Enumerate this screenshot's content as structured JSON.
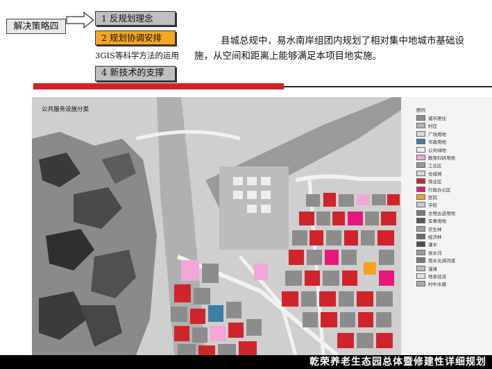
{
  "header": {
    "strategy_label": "解决策略四",
    "steps": [
      {
        "label": "1  反规划理念"
      },
      {
        "label": "2  规划协调安排"
      },
      {
        "label": "3GIS等科学方法的运用"
      },
      {
        "label": "4  新技术的支撑"
      }
    ],
    "description": "县城总规中，易水南岸组团内规划了相对集中地城市基础设施，从空间和距离上能够满足本项目地实施。"
  },
  "map": {
    "title": "公共服务设施分类",
    "legend_title": "图例",
    "legend": [
      {
        "label": "城市居住",
        "color": "#8c8c8c"
      },
      {
        "label": "村庄",
        "color": "#b5b5b5"
      },
      {
        "label": "广场用地",
        "color": "#d9d9d9"
      },
      {
        "label": "市政用地",
        "color": "#3a7fa8"
      },
      {
        "label": "公共绿地",
        "color": "#eeeeee"
      },
      {
        "label": "教育科研用地",
        "color": "#f2a6d8"
      },
      {
        "label": "工业区",
        "color": "#9a9a9a"
      },
      {
        "label": "仓储地",
        "color": "#d6d6d6"
      },
      {
        "label": "商业区",
        "color": "#d0242b"
      },
      {
        "label": "行政办公区",
        "color": "#e8177a"
      },
      {
        "label": "医院",
        "color": "#f5a31a"
      },
      {
        "label": "学校",
        "color": "#c8c8c8"
      },
      {
        "label": "文物古迹用地",
        "color": "#7a7a7a"
      },
      {
        "label": "军事用地",
        "color": "#5a5a5a"
      },
      {
        "label": "农生林",
        "color": "#a0a0a0"
      },
      {
        "label": "经济林",
        "color": "#6b6b6b"
      },
      {
        "label": "灌木",
        "color": "#4d4d4d"
      },
      {
        "label": "易水河",
        "color": "#9b9b9b"
      },
      {
        "label": "南水北调河道",
        "color": "#7d7d7d"
      },
      {
        "label": "漫滩",
        "color": "#bdbdbd"
      },
      {
        "label": "地表径流",
        "color": "#e0e0e0"
      },
      {
        "label": "村中水塘",
        "color": "#adadad"
      }
    ]
  },
  "footer": {
    "title": "乾荣养老生态园总体暨修建性详细规划"
  }
}
